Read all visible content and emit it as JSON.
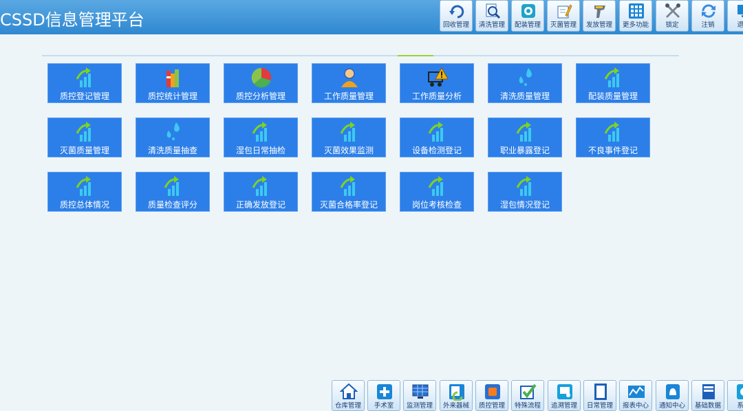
{
  "app": {
    "title": "CSSD信息管理平台"
  },
  "top_toolbar": [
    {
      "label": "回收管理",
      "icon": "recycle-arrow-icon"
    },
    {
      "label": "清洗管理",
      "icon": "wash-magnifier-icon"
    },
    {
      "label": "配装管理",
      "icon": "package-icon"
    },
    {
      "label": "灭菌管理",
      "icon": "sterilize-pen-icon"
    },
    {
      "label": "发放管理",
      "icon": "scanner-icon"
    },
    {
      "label": "更多功能",
      "icon": "grid-icon"
    },
    {
      "label": "锁定",
      "icon": "tools-icon"
    },
    {
      "label": "注销",
      "icon": "refresh-icon"
    },
    {
      "label": "退出",
      "icon": "exit-icon"
    }
  ],
  "tiles": [
    {
      "label": "质控登记管理",
      "icon": "chart-arrow-icon"
    },
    {
      "label": "质控统计管理",
      "icon": "books-icon"
    },
    {
      "label": "质控分析管理",
      "icon": "pie-chart-icon"
    },
    {
      "label": "工作质量管理",
      "icon": "users-icon"
    },
    {
      "label": "工作质量分析",
      "icon": "cart-warning-icon"
    },
    {
      "label": "清洗质量管理",
      "icon": "water-drops-icon"
    },
    {
      "label": "配装质量管理",
      "icon": "chart-arrow-icon"
    },
    {
      "label": "灭菌质量管理",
      "icon": "chart-arrow-icon"
    },
    {
      "label": "清洗质量抽查",
      "icon": "water-drops-icon"
    },
    {
      "label": "湿包日常抽检",
      "icon": "chart-arrow-icon"
    },
    {
      "label": "灭菌效果监测",
      "icon": "chart-arrow-icon"
    },
    {
      "label": "设备检测登记",
      "icon": "chart-arrow-icon"
    },
    {
      "label": "职业暴露登记",
      "icon": "chart-arrow-icon"
    },
    {
      "label": "不良事件登记",
      "icon": "chart-arrow-icon"
    },
    {
      "label": "质控总体情况",
      "icon": "chart-arrow-icon"
    },
    {
      "label": "质量检查评分",
      "icon": "chart-arrow-icon"
    },
    {
      "label": "正确发放登记",
      "icon": "chart-arrow-icon"
    },
    {
      "label": "灭菌合格率登记",
      "icon": "chart-arrow-icon"
    },
    {
      "label": "岗位考核检查",
      "icon": "chart-arrow-icon"
    },
    {
      "label": "湿包情况登记",
      "icon": "chart-arrow-icon"
    }
  ],
  "bottom_toolbar": [
    {
      "label": "仓库管理",
      "icon": "home-icon"
    },
    {
      "label": "手术室",
      "icon": "medical-cross-icon"
    },
    {
      "label": "监测管理",
      "icon": "monitor-icon"
    },
    {
      "label": "外来器械",
      "icon": "exchange-icon"
    },
    {
      "label": "质控管理",
      "icon": "quality-icon"
    },
    {
      "label": "特殊流程",
      "icon": "checkbox-icon"
    },
    {
      "label": "追溯管理",
      "icon": "trace-icon"
    },
    {
      "label": "日常管理",
      "icon": "document-icon"
    },
    {
      "label": "报表中心",
      "icon": "line-chart-icon"
    },
    {
      "label": "通知中心",
      "icon": "notice-icon"
    },
    {
      "label": "基础数据",
      "icon": "book-icon"
    },
    {
      "label": "系统",
      "icon": "system-icon"
    }
  ]
}
